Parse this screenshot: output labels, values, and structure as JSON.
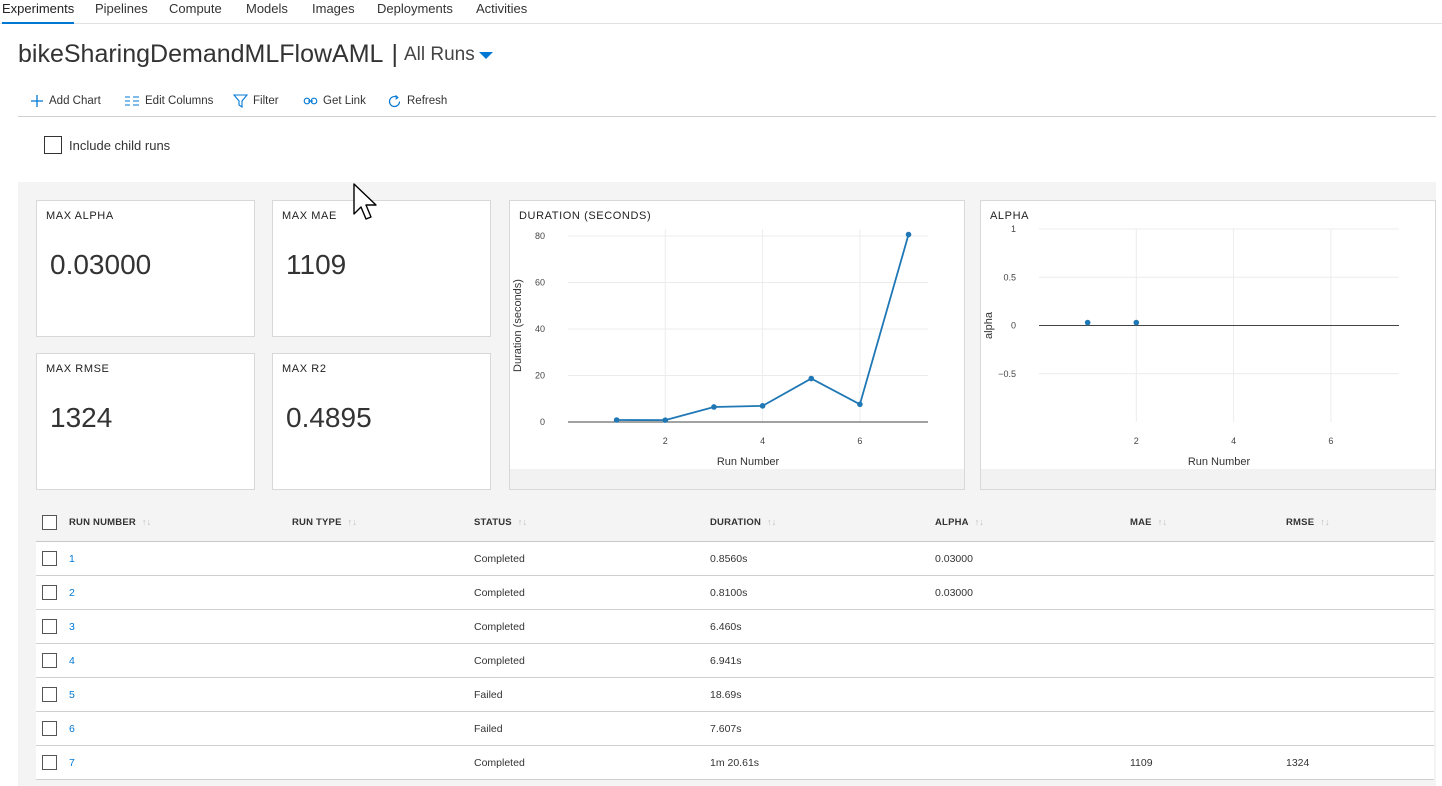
{
  "nav": {
    "tabs": [
      "Experiments",
      "Pipelines",
      "Compute",
      "Models",
      "Images",
      "Deployments",
      "Activities"
    ]
  },
  "header": {
    "experiment_name": "bikeSharingDemandMLFlowAML",
    "separator": "|",
    "view": "All Runs"
  },
  "toolbar": {
    "add_chart": "Add Chart",
    "edit_columns": "Edit Columns",
    "filter": "Filter",
    "get_link": "Get Link",
    "refresh": "Refresh"
  },
  "include_child_runs": {
    "label": "Include child runs",
    "checked": false
  },
  "metrics": {
    "max_alpha": {
      "title": "MAX ALPHA",
      "value": "0.03000"
    },
    "max_mae": {
      "title": "MAX MAE",
      "value": "1109"
    },
    "max_rmse": {
      "title": "MAX RMSE",
      "value": "1324"
    },
    "max_r2": {
      "title": "MAX R2",
      "value": "0.4895"
    }
  },
  "chart_data": [
    {
      "type": "line",
      "title": "DURATION (SECONDS)",
      "xlabel": "Run Number",
      "ylabel": "Duration (seconds)",
      "x": [
        1,
        2,
        3,
        4,
        5,
        6,
        7
      ],
      "series": [
        {
          "values": [
            0.856,
            0.81,
            6.46,
            6.941,
            18.69,
            7.607,
            80.61
          ]
        }
      ],
      "xlim": [
        0,
        7.4
      ],
      "ylim": [
        0,
        83
      ],
      "xticks": [
        2,
        4,
        6
      ],
      "yticks": [
        0,
        20,
        40,
        60,
        80
      ],
      "grid": true,
      "color": "#1f77b4"
    },
    {
      "type": "scatter",
      "title": "ALPHA",
      "xlabel": "Run Number",
      "ylabel": "alpha",
      "x": [
        1,
        2
      ],
      "series": [
        {
          "values": [
            0.03,
            0.03
          ]
        }
      ],
      "xlim": [
        0,
        7.4
      ],
      "ylim": [
        -1,
        1
      ],
      "xticks": [
        2,
        4,
        6
      ],
      "yticks": [
        1,
        0.5,
        0,
        -0.5
      ],
      "ytick_labels": [
        "1",
        "0.5",
        "0",
        "−0.5"
      ],
      "grid": true,
      "color": "#1f77b4"
    }
  ],
  "table": {
    "columns": [
      "RUN NUMBER",
      "RUN TYPE",
      "STATUS",
      "DURATION",
      "ALPHA",
      "MAE",
      "RMSE"
    ],
    "sort_icon": "↑↓",
    "rows": [
      {
        "run": "1",
        "type": "",
        "status": "Completed",
        "duration": "0.8560s",
        "alpha": "0.03000",
        "mae": "",
        "rmse": ""
      },
      {
        "run": "2",
        "type": "",
        "status": "Completed",
        "duration": "0.8100s",
        "alpha": "0.03000",
        "mae": "",
        "rmse": ""
      },
      {
        "run": "3",
        "type": "",
        "status": "Completed",
        "duration": "6.460s",
        "alpha": "",
        "mae": "",
        "rmse": ""
      },
      {
        "run": "4",
        "type": "",
        "status": "Completed",
        "duration": "6.941s",
        "alpha": "",
        "mae": "",
        "rmse": ""
      },
      {
        "run": "5",
        "type": "",
        "status": "Failed",
        "duration": "18.69s",
        "alpha": "",
        "mae": "",
        "rmse": ""
      },
      {
        "run": "6",
        "type": "",
        "status": "Failed",
        "duration": "7.607s",
        "alpha": "",
        "mae": "",
        "rmse": ""
      },
      {
        "run": "7",
        "type": "",
        "status": "Completed",
        "duration": "1m 20.61s",
        "alpha": "",
        "mae": "1109",
        "rmse": "1324"
      }
    ]
  }
}
